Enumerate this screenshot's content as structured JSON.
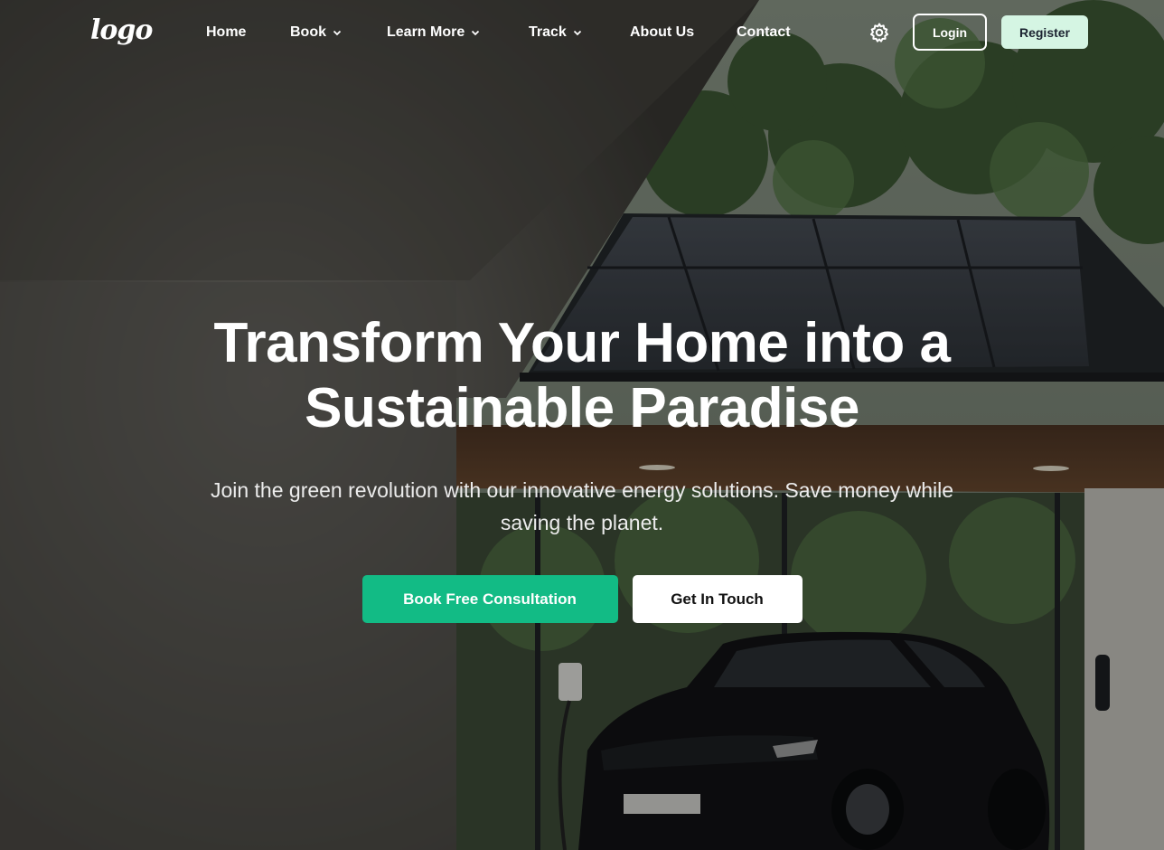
{
  "header": {
    "logo_text": "logo",
    "nav": [
      {
        "label": "Home",
        "has_dropdown": false
      },
      {
        "label": "Book",
        "has_dropdown": true
      },
      {
        "label": "Learn More",
        "has_dropdown": true
      },
      {
        "label": "Track",
        "has_dropdown": true
      },
      {
        "label": "About Us",
        "has_dropdown": false
      },
      {
        "label": "Contact",
        "has_dropdown": false
      }
    ],
    "settings_icon": "gear-icon",
    "login_label": "Login",
    "register_label": "Register"
  },
  "hero": {
    "title_line1": "Transform Your Home into a",
    "title_line2": "Sustainable Paradise",
    "subtitle": "Join the green revolution with our innovative energy solutions. Save money while saving the planet.",
    "primary_cta": "Book Free Consultation",
    "secondary_cta": "Get In Touch",
    "background_image": "modern-house-solar-panels-electric-car"
  },
  "colors": {
    "accent": "#12bb85",
    "register_bg": "#d5f5e3",
    "overlay": "#000000"
  }
}
